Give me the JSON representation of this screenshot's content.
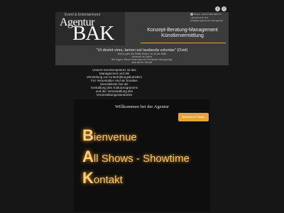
{
  "header": {
    "logo_sub": "Event & Entertainment",
    "logo_main": "Agentur",
    "logo_bak": "BAK",
    "tagline": "Konzept-Beratung-Management Künstlervermittlung",
    "phone": "Phone: +49 170 801 3947 47",
    "phone2": "+49 0174 279 75 6",
    "email": "info@bak-agentur.de | buk.agentur",
    "social": [
      "t",
      "f"
    ]
  },
  "quote": {
    "text": "\"Ut desint vires, tamen est laudanda voluntas\" (Ovid)",
    "line1": "Wenn auch die Kräfte fehlen, so ist der Wille",
    "line2": "dennoch zu loben",
    "line3": "Wir sagen: Wenn Ihnen das ein Feedback nicht genügt,",
    "line4": "sind wir für Sie da!"
  },
  "intro": [
    "Unsere Kernkompetenz ist das Management und die",
    "Vermittlung von Unterhaltungskünstlern",
    "Für Veranstalter sind wir kreative Dienstleister bei der",
    "Gestaltung des Kulturprogramms",
    "und der Veranstaltung des",
    "Veranstaltungsstandortes"
  ],
  "main": {
    "welcome": "Willkommen bei der Agentur",
    "cta": "Bewerben & Tickets",
    "menu": [
      {
        "initial": "B",
        "rest": "ienvenue"
      },
      {
        "initial": "A",
        "rest": "ll Shows - Showtime"
      },
      {
        "initial": "K",
        "rest": "ontakt"
      }
    ]
  }
}
